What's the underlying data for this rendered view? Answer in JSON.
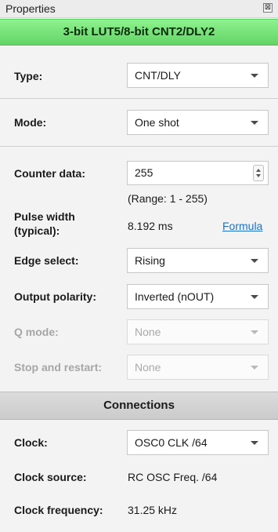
{
  "window": {
    "title": "Properties",
    "close_glyph": "⊠"
  },
  "block_title": "3-bit LUT5/8-bit CNT2/DLY2",
  "fields": {
    "type": {
      "label": "Type:",
      "value": "CNT/DLY"
    },
    "mode": {
      "label": "Mode:",
      "value": "One shot"
    },
    "counter_data": {
      "label": "Counter data:",
      "value": "255",
      "range": "(Range:  1 - 255)"
    },
    "pulse_width": {
      "label_line1": "Pulse width",
      "label_line2": "(typical):",
      "value": "8.192 ms",
      "link": "Formula"
    },
    "edge_select": {
      "label": "Edge select:",
      "value": "Rising"
    },
    "output_polarity": {
      "label": "Output polarity:",
      "value": "Inverted (nOUT)"
    },
    "q_mode": {
      "label": "Q mode:",
      "value": "None",
      "disabled": true
    },
    "stop_restart": {
      "label": "Stop and restart:",
      "value": "None",
      "disabled": true
    }
  },
  "connections": {
    "header": "Connections",
    "clock": {
      "label": "Clock:",
      "value": "OSC0 CLK /64"
    },
    "clock_source": {
      "label": "Clock source:",
      "value": "RC OSC Freq. /64"
    },
    "clock_frequency": {
      "label": "Clock frequency:",
      "value": "31.25 kHz"
    }
  },
  "colors": {
    "header_green": "#7be47d",
    "link_blue": "#1f6fc4",
    "disabled_text": "#a6a6a6"
  }
}
